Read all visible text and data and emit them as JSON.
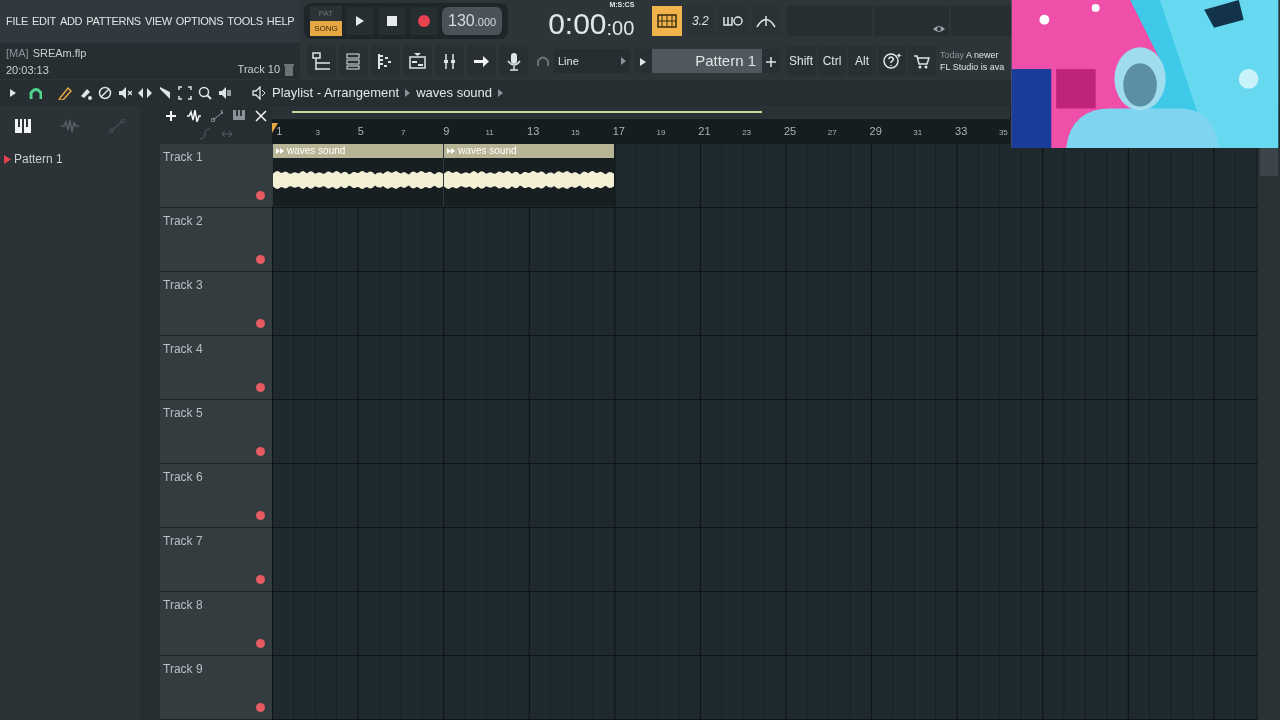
{
  "menu": [
    {
      "label": "FILE"
    },
    {
      "label": "EDIT"
    },
    {
      "label": "ADD"
    },
    {
      "label": "PATTERNS"
    },
    {
      "label": "VIEW"
    },
    {
      "label": "OPTIONS"
    },
    {
      "label": "TOOLS"
    },
    {
      "label": "HELP"
    }
  ],
  "modes": [
    {
      "label": "PAT",
      "selected": false
    },
    {
      "label": "SONG",
      "selected": true
    }
  ],
  "tempo": {
    "value": "130",
    "decimals": ".000"
  },
  "clock": {
    "value": "0:00",
    "fraction": ":00",
    "unit": "M:S:CS"
  },
  "metronome_on": true,
  "countdown": "3.2",
  "project": {
    "tag": "[MA]",
    "file": "SREAm.flp",
    "time": "20:03:13",
    "hint": "Track 10"
  },
  "input": "Line",
  "pattern": "Pattern 1",
  "modifiers": [
    "Shift",
    "Ctrl",
    "Alt"
  ],
  "news": {
    "when": "Today",
    "lines": [
      "A newer",
      "FL Studio is ava"
    ]
  },
  "playlist": {
    "breadcrumb": [
      "Playlist - Arrangement",
      "waves sound"
    ],
    "ruler": [
      {
        "label": "1",
        "major": true
      },
      {
        "label": "3",
        "major": false
      },
      {
        "label": "5",
        "major": true
      },
      {
        "label": "7",
        "major": false
      },
      {
        "label": "9",
        "major": true
      },
      {
        "label": "11",
        "major": false
      },
      {
        "label": "13",
        "major": true
      },
      {
        "label": "15",
        "major": false
      },
      {
        "label": "17",
        "major": true
      },
      {
        "label": "19",
        "major": false
      },
      {
        "label": "21",
        "major": true
      },
      {
        "label": "23",
        "major": false
      },
      {
        "label": "25",
        "major": true
      },
      {
        "label": "27",
        "major": false
      },
      {
        "label": "29",
        "major": true
      },
      {
        "label": "31",
        "major": false
      },
      {
        "label": "33",
        "major": true
      },
      {
        "label": "35",
        "major": false
      }
    ],
    "patterns": [
      {
        "label": "Pattern 1"
      }
    ],
    "tracks": [
      {
        "name": "Track 1",
        "clips": [
          {
            "label": "waves sound"
          },
          {
            "label": "waves sound"
          }
        ]
      },
      {
        "name": "Track 2"
      },
      {
        "name": "Track 3"
      },
      {
        "name": "Track 4"
      },
      {
        "name": "Track 5"
      },
      {
        "name": "Track 6"
      },
      {
        "name": "Track 7"
      },
      {
        "name": "Track 8"
      },
      {
        "name": "Track 9"
      }
    ]
  }
}
